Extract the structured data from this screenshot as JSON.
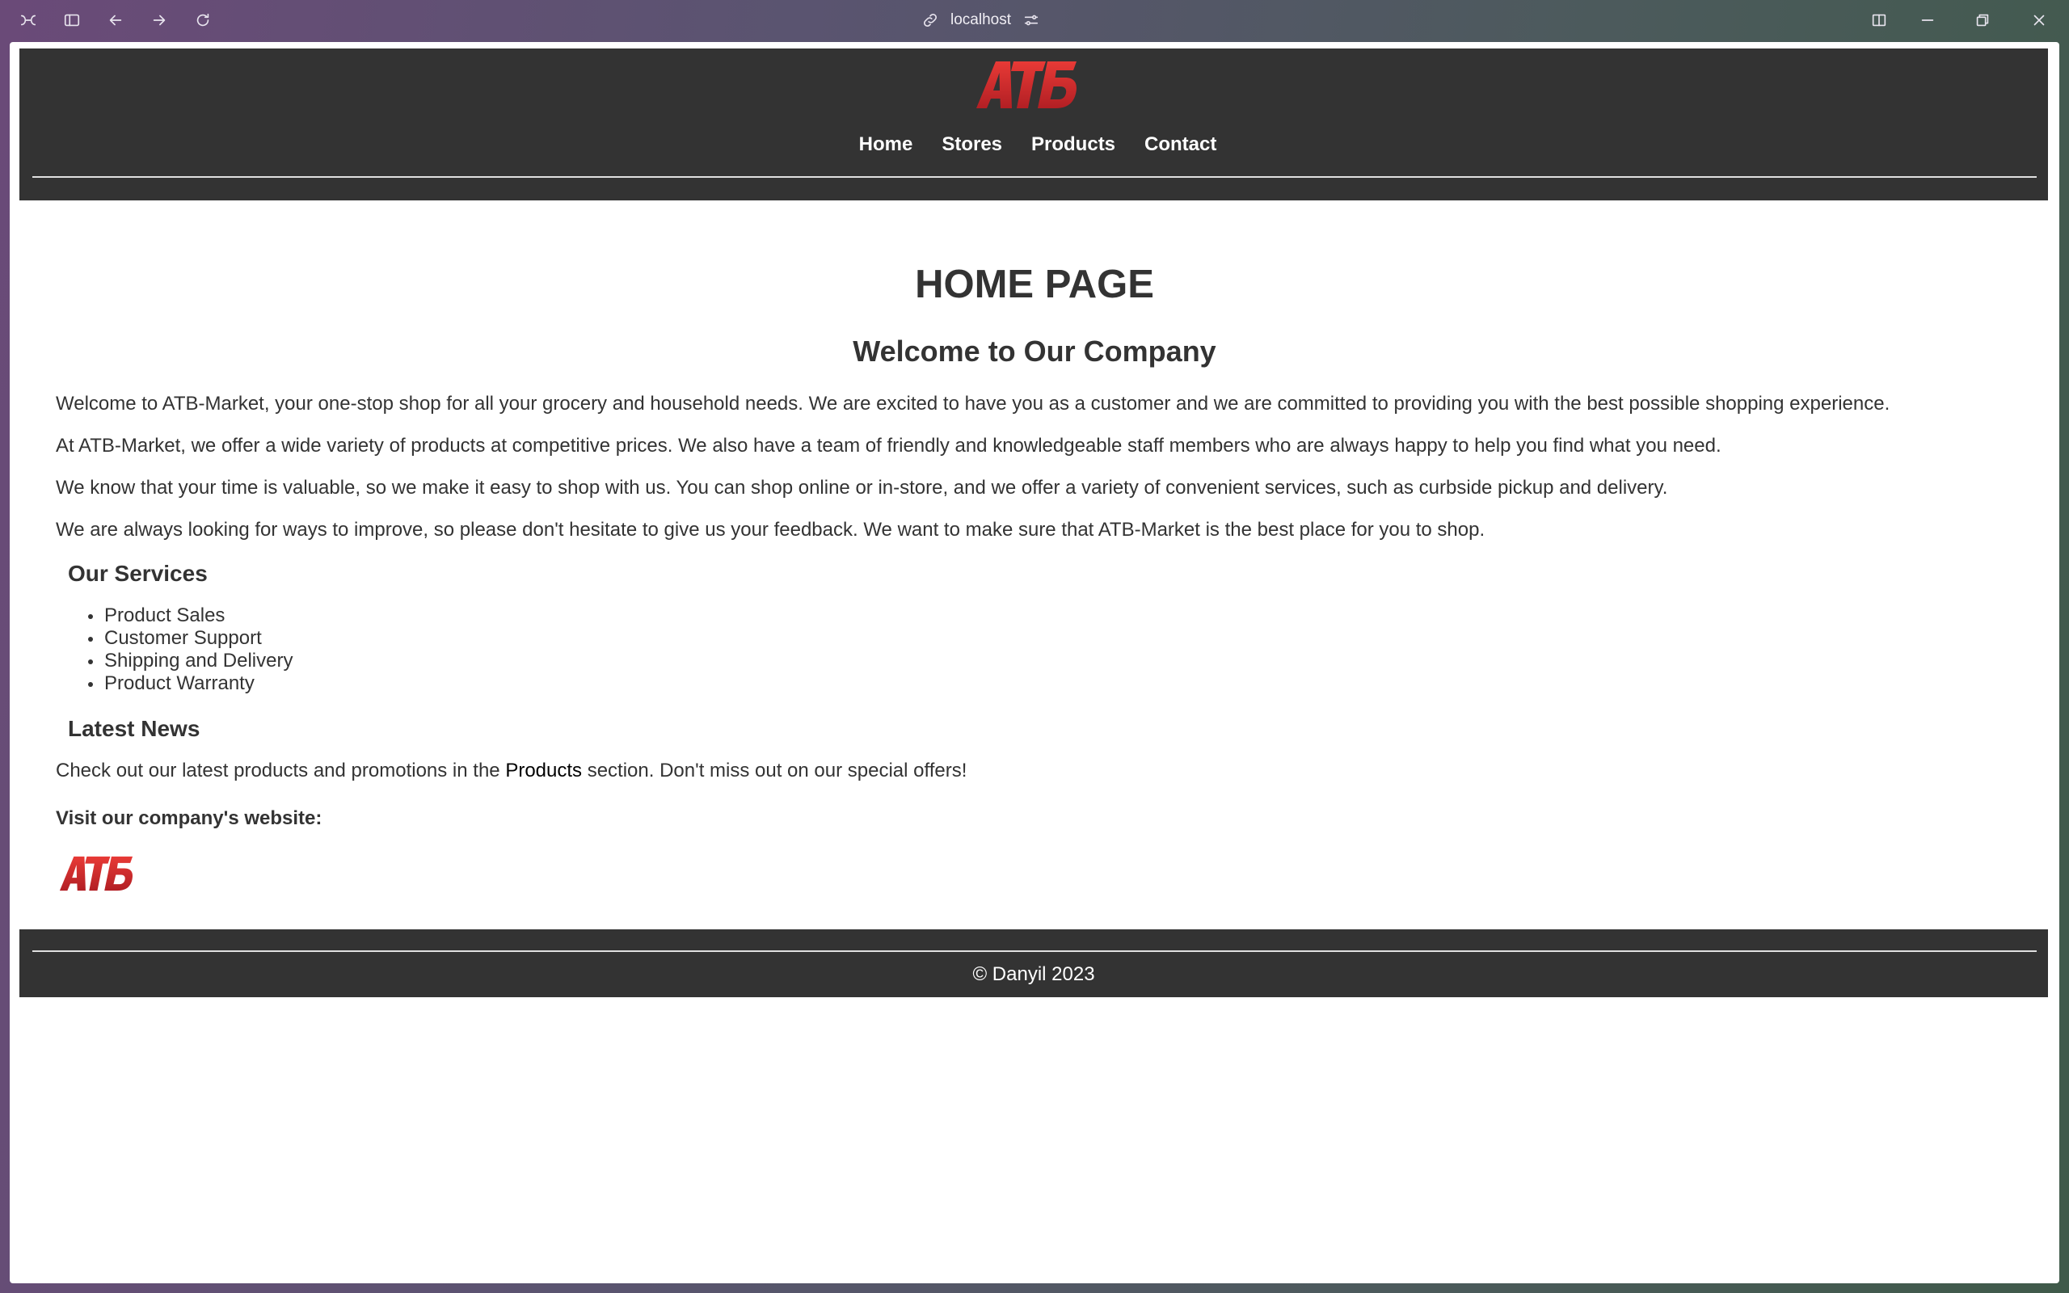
{
  "browser": {
    "url": "localhost"
  },
  "site": {
    "logo_text": "ATБ",
    "nav": [
      "Home",
      "Stores",
      "Products",
      "Contact"
    ],
    "page_title": "HOME PAGE",
    "welcome_heading": "Welcome to Our Company",
    "paragraphs": [
      "Welcome to ATB-Market, your one-stop shop for all your grocery and household needs. We are excited to have you as a customer and we are committed to providing you with the best possible shopping experience.",
      "At ATB-Market, we offer a wide variety of products at competitive prices. We also have a team of friendly and knowledgeable staff members who are always happy to help you find what you need.",
      "We know that your time is valuable, so we make it easy to shop with us. You can shop online or in-store, and we offer a variety of convenient services, such as curbside pickup and delivery.",
      "We are always looking for ways to improve, so please don't hesitate to give us your feedback. We want to make sure that ATB-Market is the best place for you to shop."
    ],
    "services_heading": "Our Services",
    "services": [
      "Product Sales",
      "Customer Support",
      "Shipping and Delivery",
      "Product Warranty"
    ],
    "news_heading": "Latest News",
    "news_before": "Check out our latest products and promotions in the ",
    "news_link": "Products",
    "news_after": " section. Don't miss out on our special offers!",
    "visit_label": "Visit our company's website:",
    "footer": "© Danyil 2023"
  },
  "colors": {
    "header_bg": "#333333",
    "logo_red": "#d82a2a",
    "text": "#333333"
  }
}
